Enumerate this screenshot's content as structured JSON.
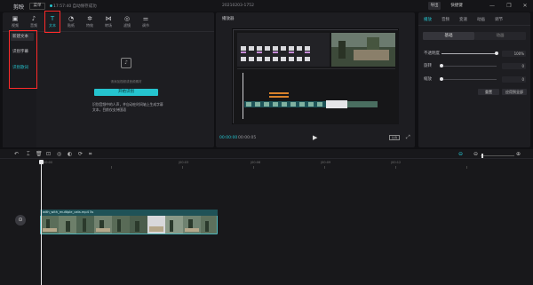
{
  "titlebar": {
    "app_name": "剪映",
    "menu_label": "菜单",
    "save_status": "17:57:40 自动保存成功",
    "project_title": "20210203-1752",
    "export_label": "导出",
    "shortcut_label": "快捷键",
    "controls": [
      "—",
      "❐",
      "✕"
    ]
  },
  "toolbar": {
    "items": [
      {
        "label": "视频",
        "icon": "video-icon"
      },
      {
        "label": "音频",
        "icon": "audio-icon"
      },
      {
        "label": "文本",
        "icon": "text-icon"
      },
      {
        "label": "贴纸",
        "icon": "sticker-icon"
      },
      {
        "label": "特效",
        "icon": "effect-icon"
      },
      {
        "label": "转场",
        "icon": "transition-icon"
      },
      {
        "label": "滤镜",
        "icon": "filter-icon"
      },
      {
        "label": "调节",
        "icon": "adjust-icon"
      }
    ],
    "active": "文本"
  },
  "sidebar": {
    "items": [
      "新建文本",
      "识别字幕",
      "识别歌词"
    ],
    "active": "识别歌词"
  },
  "media": {
    "hint": "请添加视频或音频素材",
    "button_label": "开始识别",
    "description": "识别音频中的人声，并自动在时间轴上生成字幕文本，目前仅支持国语"
  },
  "player": {
    "title": "播放器",
    "time_current": "00:00:00",
    "time_total": "00:00:05",
    "ratio_label": "比例"
  },
  "props": {
    "tabs": [
      "播放",
      "音频",
      "变速",
      "动画",
      "调节"
    ],
    "active_tab": "播放",
    "segments": [
      "基础",
      "动画"
    ],
    "active_segment": "基础",
    "rows": [
      {
        "label": "不透明度",
        "value": "100%",
        "fraction": 1.0
      },
      {
        "label": "旋转",
        "value": "0",
        "fraction": 0.0
      },
      {
        "label": "缩放",
        "value": "0",
        "fraction": 0.0
      }
    ],
    "reset_label": "重置",
    "apply_all_label": "应用到全部"
  },
  "timeline": {
    "ruler": [
      "00:00",
      "|00:03",
      "|00:06",
      "|00:09",
      "|00:12"
    ],
    "clip_label": "with_with_multiple_cats.mp4  5s"
  },
  "colors": {
    "accent": "#25c4cf",
    "highlight": "#ff2a2a",
    "clip": "#1b4a4e"
  }
}
